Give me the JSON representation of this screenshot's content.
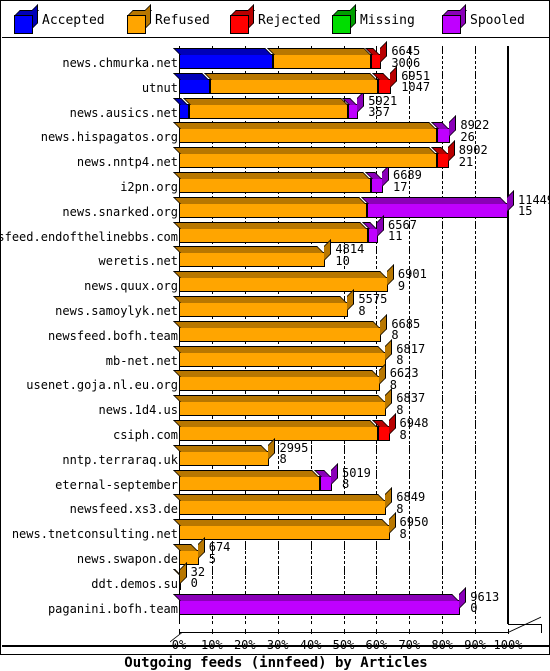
{
  "legend": {
    "items": [
      {
        "label": "Accepted",
        "color": "#0000ff",
        "key": "accepted"
      },
      {
        "label": "Refused",
        "color": "#ffa500",
        "key": "refused"
      },
      {
        "label": "Rejected",
        "color": "#ff0000",
        "key": "rejected"
      },
      {
        "label": "Missing",
        "color": "#00dd00",
        "key": "missing"
      },
      {
        "label": "Spooled",
        "color": "#bf00ff",
        "key": "spooled"
      }
    ]
  },
  "axis": {
    "ticklabels": [
      "0%",
      "10%",
      "20%",
      "30%",
      "40%",
      "50%",
      "60%",
      "70%",
      "80%",
      "90%",
      "100%"
    ],
    "min": 0,
    "max": 100
  },
  "title": "Outgoing feeds (innfeed) by Articles",
  "chart_data": {
    "type": "bar",
    "orientation": "horizontal",
    "stacked": true,
    "title": "Outgoing feeds (innfeed) by Articles",
    "xlabel": "",
    "ylabel": "",
    "xlim": [
      0,
      100
    ],
    "xunit": "percent",
    "grid": true,
    "legend_position": "top",
    "series": [
      {
        "name": "Accepted",
        "color": "#0000ff"
      },
      {
        "name": "Refused",
        "color": "#ffa500"
      },
      {
        "name": "Rejected",
        "color": "#ff0000"
      },
      {
        "name": "Missing",
        "color": "#00dd00"
      },
      {
        "name": "Spooled",
        "color": "#bf00ff"
      }
    ],
    "categories": [
      "news.chmurka.net",
      "utnut",
      "news.ausics.net",
      "news.hispagatos.org",
      "news.nntp4.net",
      "i2pn.org",
      "news.snarked.org",
      "newsfeed.endofthelinebbs.com",
      "weretis.net",
      "news.quux.org",
      "news.samoylyk.net",
      "newsfeed.bofh.team",
      "mb-net.net",
      "usenet.goja.nl.eu.org",
      "news.1d4.us",
      "csiph.com",
      "nntp.terraraq.uk",
      "eternal-september",
      "newsfeed.xs3.de",
      "news.tnetconsulting.net",
      "news.swapon.de",
      "ddt.demos.su",
      "paganini.bofh.team"
    ],
    "rows": [
      {
        "name": "news.chmurka.net",
        "value1": 6645,
        "value2": 3006,
        "total_pct": 61.5,
        "segments": [
          {
            "s": "accepted",
            "pct": 28.5
          },
          {
            "s": "refused",
            "pct": 30.0
          },
          {
            "s": "rejected",
            "pct": 3.0
          }
        ]
      },
      {
        "name": "utnut",
        "value1": 6951,
        "value2": 1047,
        "total_pct": 64.5,
        "segments": [
          {
            "s": "accepted",
            "pct": 9.5
          },
          {
            "s": "refused",
            "pct": 51.0
          },
          {
            "s": "rejected",
            "pct": 4.0
          }
        ]
      },
      {
        "name": "news.ausics.net",
        "value1": 5921,
        "value2": 357,
        "total_pct": 54.5,
        "segments": [
          {
            "s": "accepted",
            "pct": 3.0
          },
          {
            "s": "refused",
            "pct": 48.5
          },
          {
            "s": "spooled",
            "pct": 3.0
          }
        ]
      },
      {
        "name": "news.hispagatos.org",
        "value1": 8922,
        "value2": 26,
        "total_pct": 82.5,
        "segments": [
          {
            "s": "refused",
            "pct": 78.5
          },
          {
            "s": "spooled",
            "pct": 4.0
          }
        ]
      },
      {
        "name": "news.nntp4.net",
        "value1": 8902,
        "value2": 21,
        "total_pct": 82.0,
        "segments": [
          {
            "s": "refused",
            "pct": 78.5
          },
          {
            "s": "rejected",
            "pct": 3.5
          }
        ]
      },
      {
        "name": "i2pn.org",
        "value1": 6689,
        "value2": 17,
        "total_pct": 62.0,
        "segments": [
          {
            "s": "refused",
            "pct": 58.5
          },
          {
            "s": "spooled",
            "pct": 3.5
          }
        ]
      },
      {
        "name": "news.snarked.org",
        "value1": 11449,
        "value2": 15,
        "total_pct": 100.0,
        "segments": [
          {
            "s": "refused",
            "pct": 57.0
          },
          {
            "s": "spooled",
            "pct": 43.0
          }
        ]
      },
      {
        "name": "newsfeed.endofthelinebbs.com",
        "value1": 6567,
        "value2": 11,
        "total_pct": 60.5,
        "segments": [
          {
            "s": "refused",
            "pct": 57.5
          },
          {
            "s": "spooled",
            "pct": 3.0
          }
        ]
      },
      {
        "name": "weretis.net",
        "value1": 4814,
        "value2": 10,
        "total_pct": 44.5,
        "segments": [
          {
            "s": "refused",
            "pct": 44.5
          }
        ]
      },
      {
        "name": "news.quux.org",
        "value1": 6901,
        "value2": 9,
        "total_pct": 63.5,
        "segments": [
          {
            "s": "refused",
            "pct": 63.5
          }
        ]
      },
      {
        "name": "news.samoylyk.net",
        "value1": 5575,
        "value2": 8,
        "total_pct": 51.5,
        "segments": [
          {
            "s": "refused",
            "pct": 51.5
          }
        ]
      },
      {
        "name": "newsfeed.bofh.team",
        "value1": 6685,
        "value2": 8,
        "total_pct": 61.5,
        "segments": [
          {
            "s": "refused",
            "pct": 61.5
          }
        ]
      },
      {
        "name": "mb-net.net",
        "value1": 6817,
        "value2": 8,
        "total_pct": 63.0,
        "segments": [
          {
            "s": "refused",
            "pct": 63.0
          }
        ]
      },
      {
        "name": "usenet.goja.nl.eu.org",
        "value1": 6623,
        "value2": 8,
        "total_pct": 61.0,
        "segments": [
          {
            "s": "refused",
            "pct": 61.0
          }
        ]
      },
      {
        "name": "news.1d4.us",
        "value1": 6837,
        "value2": 8,
        "total_pct": 63.0,
        "segments": [
          {
            "s": "refused",
            "pct": 63.0
          }
        ]
      },
      {
        "name": "csiph.com",
        "value1": 6948,
        "value2": 8,
        "total_pct": 64.0,
        "segments": [
          {
            "s": "refused",
            "pct": 60.5
          },
          {
            "s": "rejected",
            "pct": 3.5
          }
        ]
      },
      {
        "name": "nntp.terraraq.uk",
        "value1": 2995,
        "value2": 8,
        "total_pct": 27.5,
        "segments": [
          {
            "s": "refused",
            "pct": 27.5
          }
        ]
      },
      {
        "name": "eternal-september",
        "value1": 5019,
        "value2": 8,
        "total_pct": 46.5,
        "segments": [
          {
            "s": "refused",
            "pct": 43.0
          },
          {
            "s": "spooled",
            "pct": 3.5
          }
        ]
      },
      {
        "name": "newsfeed.xs3.de",
        "value1": 6849,
        "value2": 8,
        "total_pct": 63.0,
        "segments": [
          {
            "s": "refused",
            "pct": 63.0
          }
        ]
      },
      {
        "name": "news.tnetconsulting.net",
        "value1": 6950,
        "value2": 8,
        "total_pct": 64.0,
        "segments": [
          {
            "s": "refused",
            "pct": 64.0
          }
        ]
      },
      {
        "name": "news.swapon.de",
        "value1": 674,
        "value2": 5,
        "total_pct": 6.0,
        "segments": [
          {
            "s": "refused",
            "pct": 6.0
          }
        ]
      },
      {
        "name": "ddt.demos.su",
        "value1": 32,
        "value2": 0,
        "total_pct": 0.5,
        "segments": [
          {
            "s": "refused",
            "pct": 0.5
          }
        ]
      },
      {
        "name": "paganini.bofh.team",
        "value1": 9613,
        "value2": 0,
        "total_pct": 85.5,
        "segments": [
          {
            "s": "spooled",
            "pct": 85.5
          }
        ]
      }
    ]
  }
}
